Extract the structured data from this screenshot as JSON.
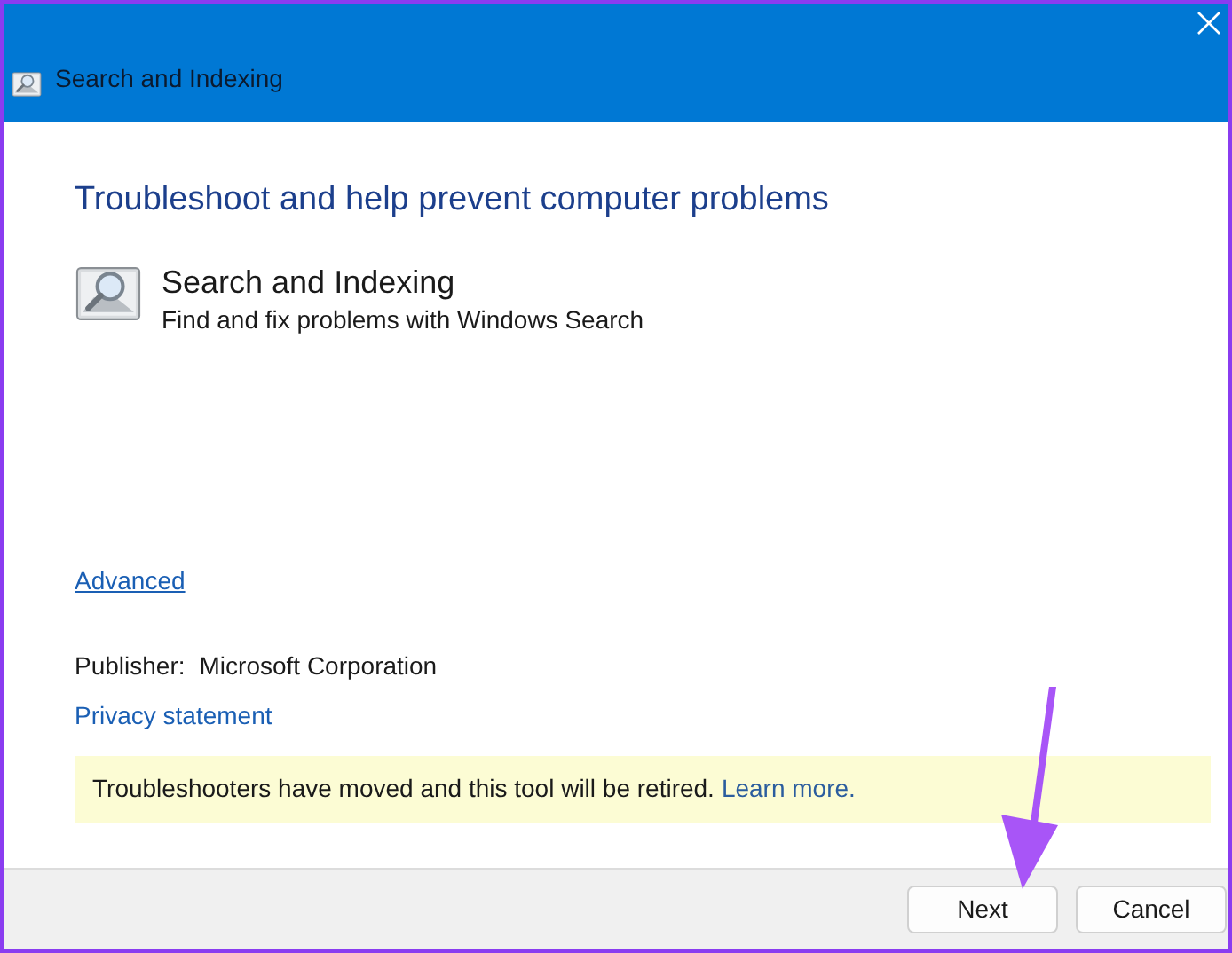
{
  "window": {
    "title": "Search and Indexing"
  },
  "heading": "Troubleshoot and help prevent computer problems",
  "troubleshooter": {
    "name": "Search and Indexing",
    "description": "Find and fix problems with Windows Search"
  },
  "advanced_link": "Advanced",
  "publisher": {
    "label": "Publisher:",
    "value": "Microsoft Corporation"
  },
  "privacy_link": "Privacy statement",
  "notice": {
    "text": "Troubleshooters have moved and this tool will be retired.",
    "link": "Learn more."
  },
  "buttons": [
    {
      "label": "Next"
    },
    {
      "label": "Cancel"
    }
  ]
}
